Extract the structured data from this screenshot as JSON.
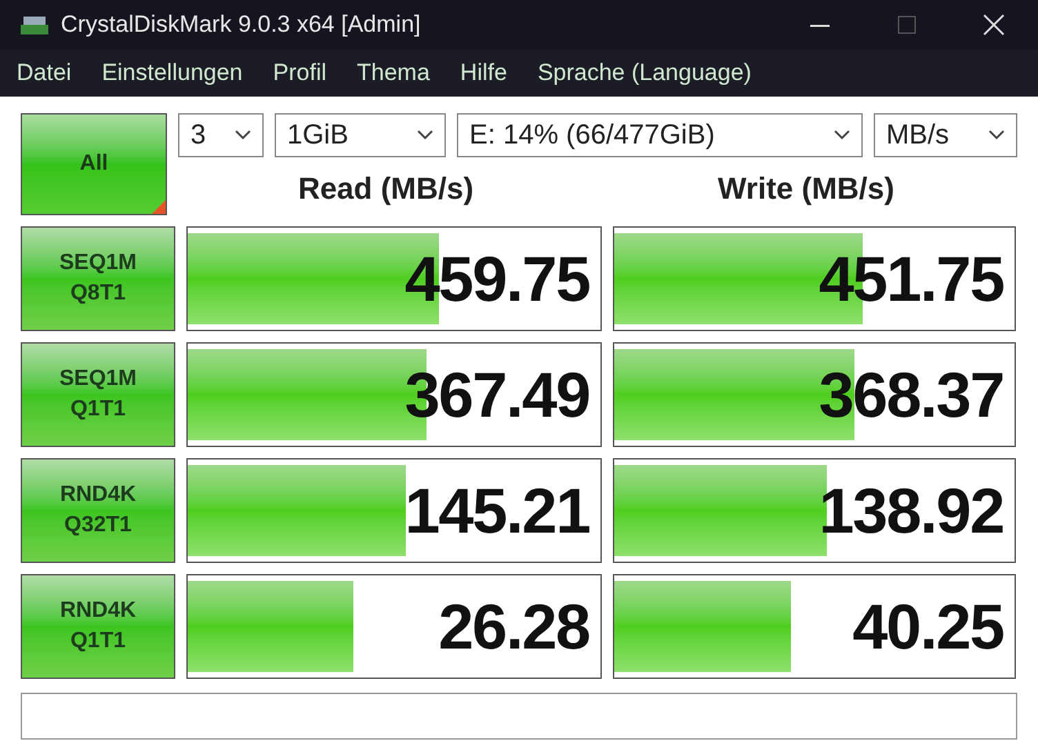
{
  "window": {
    "title": "CrystalDiskMark 9.0.3 x64 [Admin]"
  },
  "menu": [
    "Datei",
    "Einstellungen",
    "Profil",
    "Thema",
    "Hilfe",
    "Sprache (Language)"
  ],
  "all_button": "All",
  "selects": [
    {
      "value": "3"
    },
    {
      "value": "1GiB"
    },
    {
      "value": "E: 14% (66/477GiB)"
    },
    {
      "value": "MB/s"
    }
  ],
  "headers": [
    "Read (MB/s)",
    "Write (MB/s)"
  ],
  "rows": [
    {
      "test": [
        "SEQ1M",
        "Q8T1"
      ],
      "read": {
        "value": "459.75",
        "level": 0.61
      },
      "write": {
        "value": "451.75",
        "level": 0.62
      }
    },
    {
      "test": [
        "SEQ1M",
        "Q1T1"
      ],
      "read": {
        "value": "367.49",
        "level": 0.58
      },
      "write": {
        "value": "368.37",
        "level": 0.6
      }
    },
    {
      "test": [
        "RND4K",
        "Q32T1"
      ],
      "read": {
        "value": "145.21",
        "level": 0.53
      },
      "write": {
        "value": "138.92",
        "level": 0.53
      }
    },
    {
      "test": [
        "RND4K",
        "Q1T1"
      ],
      "read": {
        "value": "26.28",
        "level": 0.4
      },
      "write": {
        "value": "40.25",
        "level": 0.44
      }
    }
  ]
}
